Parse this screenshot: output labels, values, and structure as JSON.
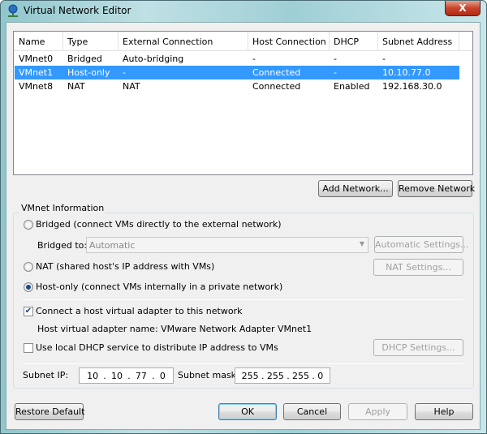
{
  "window": {
    "title": "Virtual Network Editor",
    "close": "X"
  },
  "table": {
    "headers": [
      "Name",
      "Type",
      "External Connection",
      "Host Connection",
      "DHCP",
      "Subnet Address"
    ],
    "rows": [
      [
        "VMnet0",
        "Bridged",
        "Auto-bridging",
        "-",
        "-",
        "-"
      ],
      [
        "VMnet1",
        "Host-only",
        "-",
        "Connected",
        "-",
        "10.10.77.0"
      ],
      [
        "VMnet8",
        "NAT",
        "NAT",
        "Connected",
        "Enabled",
        "192.168.30.0"
      ]
    ],
    "selected_row": 1
  },
  "actions": {
    "add_network": "Add Network...",
    "remove_network": "Remove Network"
  },
  "info": {
    "group_label": "VMnet Information",
    "bridged": "Bridged (connect VMs directly to the external network)",
    "bridged_to_label": "Bridged to:",
    "bridged_to_value": "Automatic",
    "automatic_settings": "Automatic Settings...",
    "nat": "NAT (shared host's IP address with VMs)",
    "nat_settings": "NAT Settings...",
    "host_only": "Host-only (connect VMs internally in a private network)",
    "connect_adapter": "Connect a host virtual adapter to this network",
    "adapter_name": "Host virtual adapter name: VMware Network Adapter VMnet1",
    "use_dhcp": "Use local DHCP service to distribute IP address to VMs",
    "dhcp_settings": "DHCP Settings...",
    "subnet_ip_label": "Subnet IP:",
    "subnet_ip": [
      "10",
      "10",
      "77",
      "0"
    ],
    "subnet_mask_label": "Subnet mask:",
    "subnet_mask": [
      "255",
      "255",
      "255",
      "0"
    ],
    "dot": "."
  },
  "footer": {
    "restore": "Restore Default",
    "ok": "OK",
    "cancel": "Cancel",
    "apply": "Apply",
    "help": "Help"
  }
}
